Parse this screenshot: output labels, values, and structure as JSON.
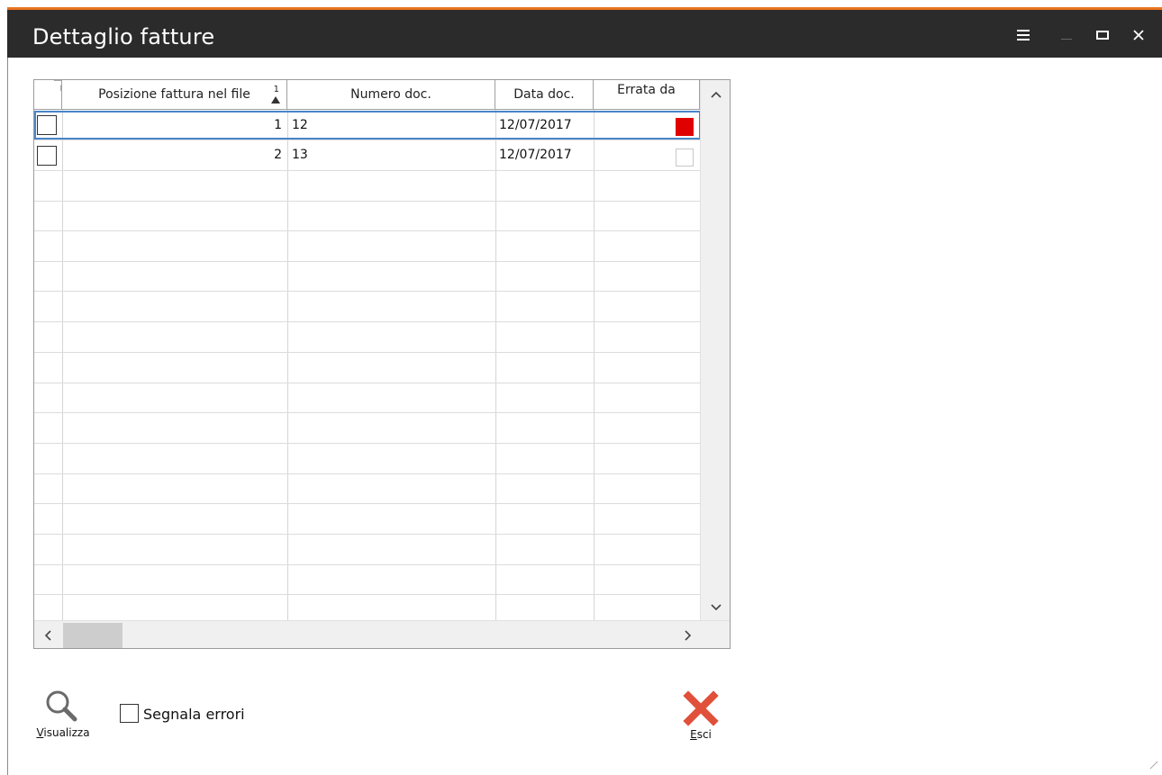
{
  "window": {
    "title": "Dettaglio fatture",
    "menu_icon": "hamburger-icon",
    "minimize_icon": "minimize-icon",
    "maximize_icon": "maximize-icon",
    "close_icon": "close-icon",
    "accent_color": "#e8731c",
    "titlebar_color": "#2b2b2b"
  },
  "grid": {
    "columns": [
      {
        "label": ""
      },
      {
        "label": "Posizione fattura nel file",
        "sort_indicator": "1"
      },
      {
        "label": "Numero doc."
      },
      {
        "label": "Data doc."
      },
      {
        "label": "Errata da"
      }
    ],
    "rows": [
      {
        "selected": false,
        "posizione": "1",
        "numero": "12",
        "data": "12/07/2017",
        "errata": true
      },
      {
        "selected": false,
        "posizione": "2",
        "numero": "13",
        "data": "12/07/2017",
        "errata": false
      }
    ],
    "error_color": "#e00000",
    "selection_color": "#4a86c8"
  },
  "footer": {
    "visualizza_label": "Visualizza",
    "visualizza_icon": "magnifier-icon",
    "segnala_label": "Segnala errori",
    "segnala_checked": false,
    "esci_label": "Esci",
    "esci_icon": "red-x-icon"
  }
}
